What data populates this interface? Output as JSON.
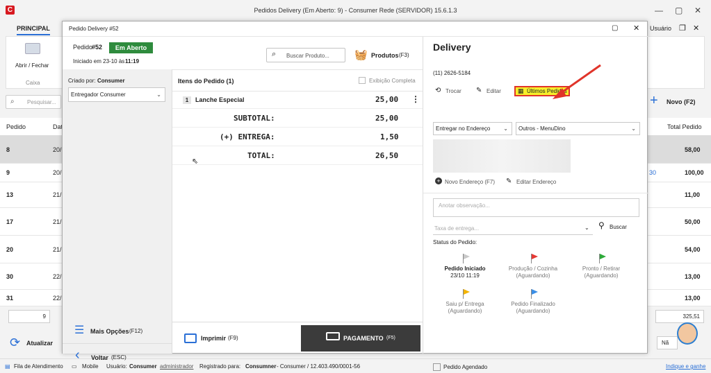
{
  "app": {
    "title": "Pedidos Delivery (Em Aberto: 9) - Consumer Rede (SERVIDOR) 15.6.1.3",
    "logo": "C"
  },
  "menu": {
    "principal": "PRINCIPAL",
    "user": "Usuário"
  },
  "ribbon": {
    "open_close": "Abrir / Fechar",
    "group": "Caixa"
  },
  "back": {
    "search_placeholder": "Pesquisar...",
    "new_label": "Novo (F2)",
    "refresh": "Atualizar",
    "page": "9",
    "partial_total": "325,51",
    "partial_no": "Nã",
    "headers": {
      "pedido": "Pedido",
      "data": "Dat",
      "total": "Total Pedido"
    },
    "rows": [
      {
        "pedido": "8",
        "data": "20/",
        "total": "58,00"
      },
      {
        "pedido": "9",
        "data": "20/",
        "total": "100,00",
        "extra": "30"
      },
      {
        "pedido": "13",
        "data": "21/",
        "total": "11,00"
      },
      {
        "pedido": "17",
        "data": "21/",
        "total": "50,00"
      },
      {
        "pedido": "20",
        "data": "21/",
        "total": "54,00"
      },
      {
        "pedido": "30",
        "data": "22/",
        "total": "13,00"
      },
      {
        "pedido": "31",
        "data": "22/",
        "total": "13,00"
      }
    ]
  },
  "dialog": {
    "title": "Pedido Delivery #52",
    "order_prefix": "Pedido ",
    "order_no": "#52",
    "status_badge": "Em Aberto",
    "started_prefix": "Iniciado em 23-10 às ",
    "started_time": "11:19",
    "search_product": "Buscar Produto...",
    "products_btn": "Produtos",
    "products_key": "(F3)",
    "created_by_prefix": "Criado por: ",
    "created_by": "Consumer",
    "deliverer": "Entregador Consumer",
    "items_header": "Itens do Pedido (1)",
    "complete_view": "Exibição Completa",
    "items": [
      {
        "qty": "1",
        "name": "Lanche Especial",
        "value": "25,00"
      }
    ],
    "subtotal_label": "SUBTOTAL:",
    "subtotal": "25,00",
    "delivery_label": "(+) ENTREGA:",
    "delivery": "1,50",
    "total_label": "TOTAL:",
    "total": "26,50",
    "more_options": "Mais Opções",
    "more_key": "(F12)",
    "back_btn": "Voltar",
    "back_key": "(ESC)",
    "print_btn": "Imprimir",
    "print_key": "(F9)",
    "payment_btn": "PAGAMENTO",
    "payment_key": "(F5)",
    "delivery_title": "Delivery",
    "phone": "(11) 2626-5184",
    "swap": "Trocar",
    "edit": "Editar",
    "last_orders": "Últimos Pedidos",
    "delivery_mode": "Entregar no Endereço",
    "channel": "Outros - MenuDino",
    "new_address": "Novo Endereço (F7)",
    "edit_address": "Editar Endereço",
    "obs_placeholder": "Anotar observação...",
    "fee_placeholder": "Taxa de entrega...",
    "search_btn": "Buscar",
    "status_title": "Status do Pedido:",
    "statuses": [
      {
        "label": "Pedido Iniciado",
        "sub": "23/10 11:19",
        "color": "#c8c8c8"
      },
      {
        "label": "Produção / Cozinha",
        "sub": "(Aguardando)",
        "color": "#e53935"
      },
      {
        "label": "Pronto / Retirar",
        "sub": "(Aguardando)",
        "color": "#2eaa3a"
      },
      {
        "label": "Saiu p/ Entrega",
        "sub": "(Aguardando)",
        "color": "#f4b400"
      },
      {
        "label": "Pedido Finalizado",
        "sub": "(Aguardando)",
        "color": "#3a8ee6"
      }
    ],
    "scheduled": "Pedido Agendado",
    "colors": {
      "badge": "#2e8b3d",
      "payment_bg": "#3b3b3b",
      "highlight_bg": "#f7ef2a",
      "highlight_border": "#e0342a",
      "arrow": "#e0342a",
      "accent": "#2a6fd6"
    }
  },
  "status": {
    "queue": "Fila de Atendimento",
    "mobile": "Mobile",
    "user_prefix": "Usuário: ",
    "user": "Consumer",
    "user_role": "administrador",
    "registered_prefix": "Registrado para: ",
    "registered": "Consumner",
    "registered_rest": " - Consumer / 12.403.490/0001-56",
    "refer": "Indique e ganhe"
  }
}
